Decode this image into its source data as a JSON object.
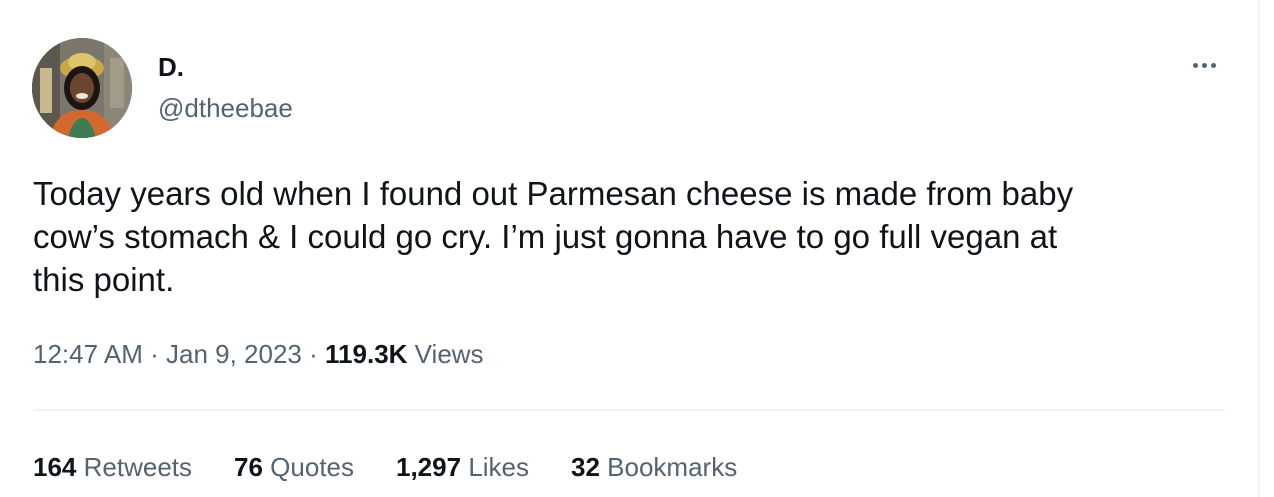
{
  "author": {
    "display_name": "D.",
    "handle": "@dtheebae",
    "avatar_icon": "profile-photo"
  },
  "tweet": {
    "text": "Today years old when I found out Parmesan cheese is made from baby\ncow’s stomach & I could go cry. I’m just gonna have to go full vegan at\nthis point."
  },
  "meta": {
    "time": "12:47 AM",
    "separator": "·",
    "date": "Jan 9, 2023",
    "views_count": "119.3K",
    "views_label": "Views"
  },
  "stats": {
    "retweets_count": "164",
    "retweets_label": "Retweets",
    "quotes_count": "76",
    "quotes_label": "Quotes",
    "likes_count": "1,297",
    "likes_label": "Likes",
    "bookmarks_count": "32",
    "bookmarks_label": "Bookmarks"
  },
  "icons": {
    "more": "more-horizontal-icon"
  },
  "colors": {
    "text_primary": "#0f1419",
    "text_secondary": "#536471",
    "divider": "#eff3f4"
  }
}
